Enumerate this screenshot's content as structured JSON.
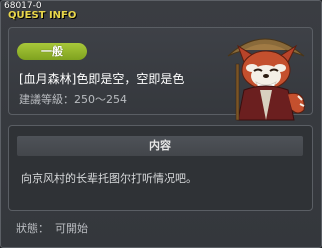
{
  "window": {
    "quest_id": "68017-0",
    "title": "QUEST INFO"
  },
  "quest": {
    "category": "一般",
    "name": "[血月森林]色即是空，空即是色",
    "level_requirement": "建議等級：250〜254"
  },
  "content": {
    "header": "内容",
    "text": "向京风村的长辈托图尔打听情况吧。"
  },
  "status": {
    "label": "狀態：",
    "value": "可開始"
  },
  "colors": {
    "title": "#e8d64a",
    "badge": "#8fb02a",
    "panel_border": "#5a5e64"
  },
  "icons": {
    "portrait": "red-panda-npc-portrait"
  }
}
